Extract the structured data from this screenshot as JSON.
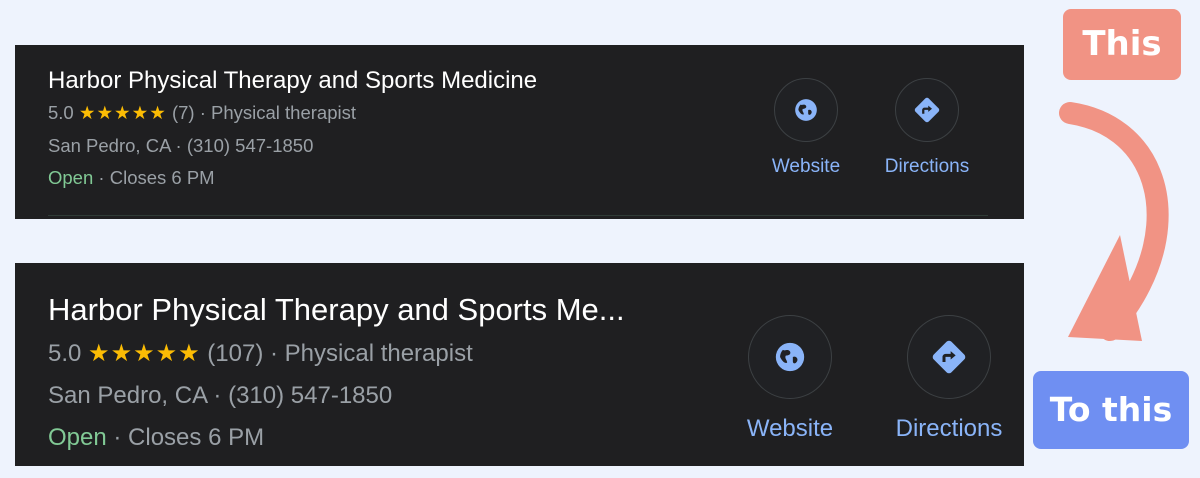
{
  "before": {
    "title": "Harbor Physical Therapy and Sports Medicine",
    "rating": "5.0",
    "stars": "★★★★★",
    "reviews": "(7)",
    "category": "Physical therapist",
    "location": "San Pedro, CA",
    "phone": "(310) 547-1850",
    "status": "Open",
    "hours": "Closes 6 PM",
    "separator": " · ",
    "website_label": "Website",
    "directions_label": "Directions"
  },
  "after": {
    "title": "Harbor Physical Therapy and Sports Me...",
    "rating": "5.0",
    "stars": "★★★★★",
    "reviews": "(107)",
    "category": "Physical therapist",
    "location": "San Pedro, CA",
    "phone": "(310) 547-1850",
    "status": "Open",
    "hours": "Closes 6 PM",
    "separator": " · ",
    "website_label": "Website",
    "directions_label": "Directions"
  },
  "annotations": {
    "this_label": "This",
    "to_this_label": "To this",
    "this_color": "#f19384",
    "to_this_color": "#6f8ff2",
    "arrow_icon": "curved-arrow-down-icon"
  },
  "colors": {
    "card_bg": "#1f1f21",
    "link_blue": "#8ab4f8",
    "star_yellow": "#fbbc04",
    "open_green": "#81c995",
    "muted_text": "#9aa0a6"
  }
}
